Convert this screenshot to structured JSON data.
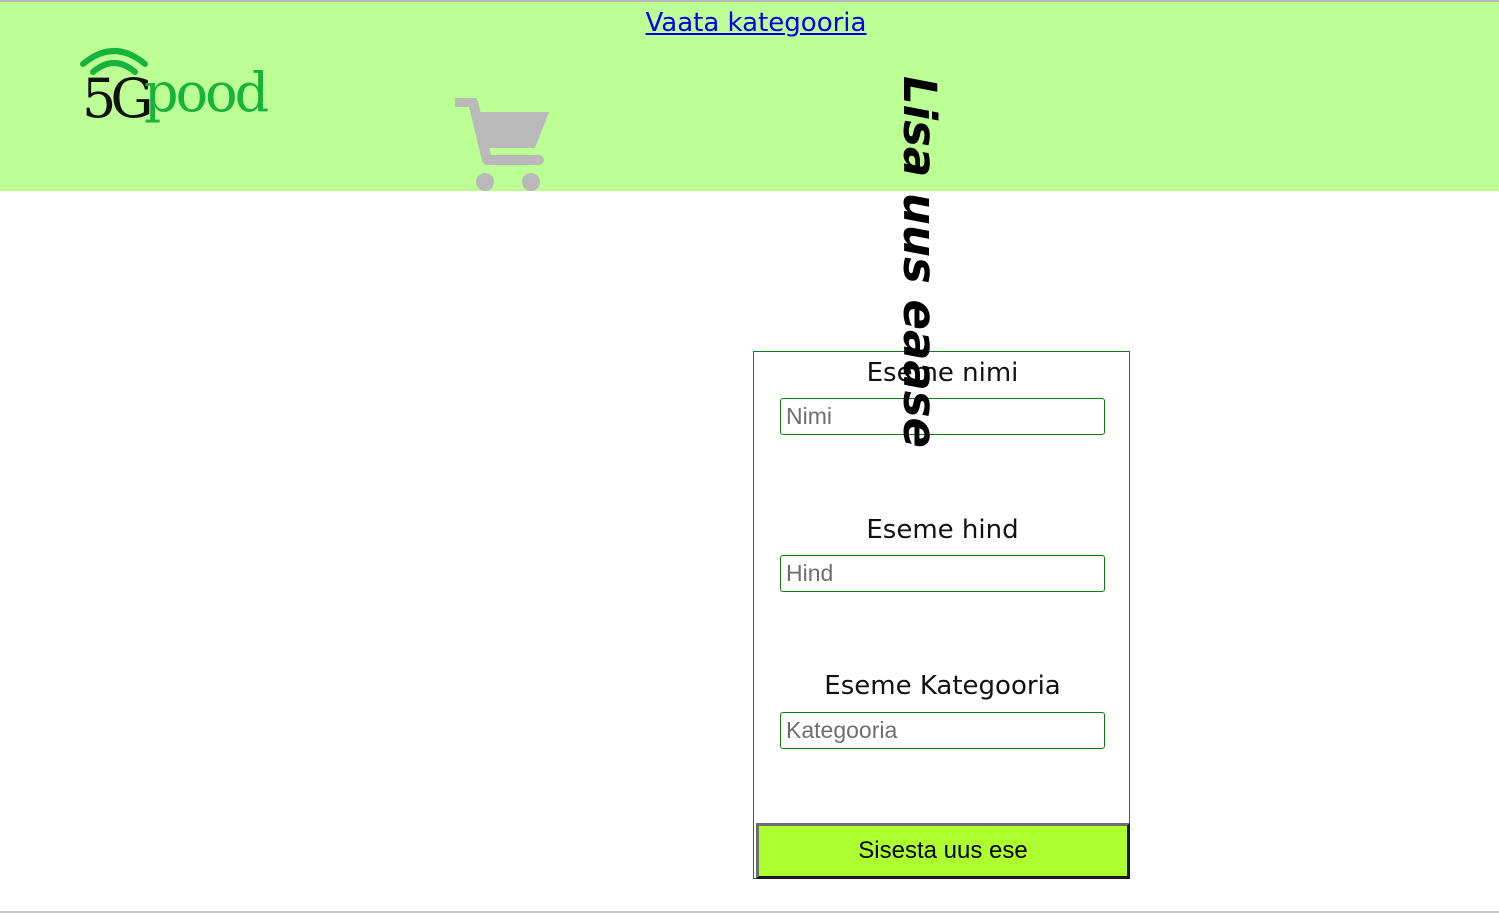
{
  "header": {
    "nav_link": "Vaata kategooria",
    "logo": {
      "part1": "5G",
      "part2": "pood"
    },
    "cart_icon": "shopping-cart-icon",
    "background_color": "#bbff95"
  },
  "page_title": "Lisa uus eaase",
  "form": {
    "fields": [
      {
        "label": "Eseme nimi",
        "placeholder": "Nimi"
      },
      {
        "label": "Eseme hind",
        "placeholder": "Hind"
      },
      {
        "label": "Eseme Kategooria",
        "placeholder": "Kategooria"
      }
    ],
    "submit_label": "Sisesta uus ese",
    "border_color": "#137a13",
    "button_color": "#adff2f"
  }
}
